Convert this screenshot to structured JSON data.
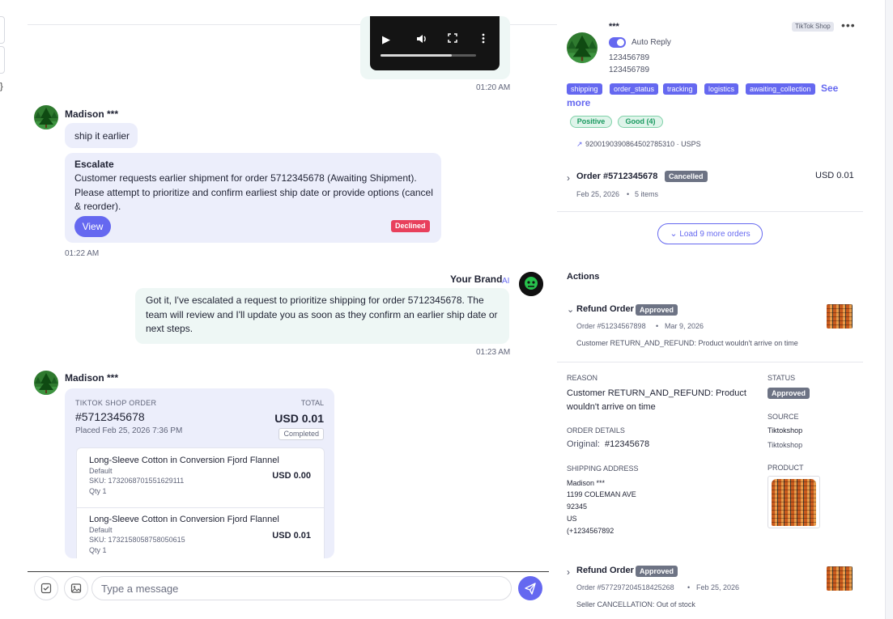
{
  "chat": {
    "video_time": "01:20 AM",
    "msg1": {
      "sender": "Madison ***",
      "text": "ship it earlier"
    },
    "escalate": {
      "title": "Escalate",
      "body": "Customer requests earlier shipment for order 5712345678 (Awaiting Shipment). Please attempt to prioritize and confirm earliest ship date or provide options (cancel & reorder).",
      "view_label": "View",
      "status": "Declined",
      "time": "01:22 AM"
    },
    "reply": {
      "sender": "Your Brand",
      "ai_label": "AI",
      "text": "Got it, I've escalated a request to prioritize shipping for order 5712345678. The team will review and I'll update you as soon as they confirm an earlier ship date or next steps.",
      "time": "01:23 AM"
    },
    "msg2": {
      "sender": "Madison ***"
    },
    "order_card": {
      "label": "TIKTOK SHOP ORDER",
      "total_label": "TOTAL",
      "number": "#5712345678",
      "total": "USD 0.01",
      "placed": "Placed Feb 25, 2026 7:36 PM",
      "status": "Completed",
      "items": [
        {
          "name": "Long-Sleeve Cotton in Conversion Fjord Flannel",
          "variant": "Default",
          "sku": "SKU: 1732068701551629111",
          "qty": "Qty 1",
          "price": "USD 0.00"
        },
        {
          "name": "Long-Sleeve Cotton in Conversion Fjord Flannel",
          "variant": "Default",
          "sku": "SKU: 1732158058758050615",
          "qty": "Qty 1",
          "price": "USD 0.01"
        }
      ]
    },
    "composer": {
      "placeholder": "Type a message"
    }
  },
  "profile": {
    "name": "***",
    "channel": "TikTok Shop",
    "auto_reply": "Auto Reply",
    "id1": "123456789",
    "id2": "123456789",
    "tags": [
      "shipping",
      "order_status",
      "tracking",
      "logistics",
      "awaiting_collection"
    ],
    "see_more_1": "See",
    "see_more_2": "more",
    "sentiment": "Positive",
    "rating": "Good (4)"
  },
  "orders": {
    "tracking": "92001903908645027853​10",
    "tracking_display": "9200190390864502785310 · USPS",
    "order": {
      "number": "Order #5712345678",
      "status": "Cancelled",
      "amount": "USD 0.01",
      "date": "Feb 25, 2026",
      "items": "5 items"
    },
    "load_more": "Load 9 more orders"
  },
  "actions": {
    "title": "Actions",
    "refund1": {
      "title": "Refund Order",
      "status": "Approved",
      "order": "Order #51234567898",
      "date": "Mar 9, 2026",
      "summary": "Customer RETURN_AND_REFUND: Product wouldn't arrive on time",
      "reason_label": "REASON",
      "reason": "Customer RETURN_AND_REFUND: Product wouldn't arrive on time",
      "status_label": "STATUS",
      "status_value": "Approved",
      "order_details_label": "ORDER DETAILS",
      "original_label": "Original:",
      "original_value": "#12345678",
      "source_label": "SOURCE",
      "source1": "Tiktokshop",
      "source2": "Tiktokshop",
      "shipping_label": "SHIPPING ADDRESS",
      "address": [
        "Madison ***",
        "1199 COLEMAN AVE",
        "92345",
        "US",
        "(+1234567892"
      ],
      "product_label": "PRODUCT"
    },
    "refund2": {
      "title": "Refund Order",
      "status": "Approved",
      "order": "Order #577297204518425268",
      "date": "Feb 25, 2026",
      "summary": "Seller CANCELLATION: Out of stock"
    }
  }
}
